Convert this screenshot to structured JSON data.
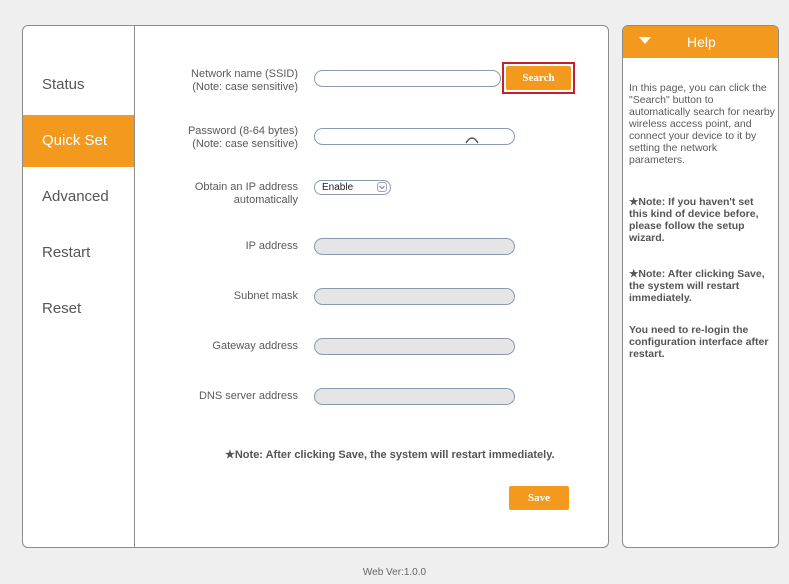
{
  "sidebar": {
    "items": [
      {
        "label": "Status",
        "active": false
      },
      {
        "label": "Quick Set",
        "active": true
      },
      {
        "label": "Advanced",
        "active": false
      },
      {
        "label": "Restart",
        "active": false
      },
      {
        "label": "Reset",
        "active": false
      }
    ]
  },
  "form": {
    "ssid": {
      "label_line1": "Network name (SSID)",
      "label_line2": "(Note: case sensitive)",
      "value": ""
    },
    "search_label": "Search",
    "password": {
      "label_line1": "Password (8-64 bytes)",
      "label_line2": "(Note: case sensitive)",
      "value": ""
    },
    "obtain_ip": {
      "label_line1": "Obtain an IP address",
      "label_line2": "automatically",
      "selected": "Enable"
    },
    "ip_address": {
      "label": "IP address",
      "value": ""
    },
    "subnet_mask": {
      "label": "Subnet mask",
      "value": ""
    },
    "gateway": {
      "label": "Gateway address",
      "value": ""
    },
    "dns": {
      "label": "DNS server address",
      "value": ""
    },
    "note": "★Note: After clicking Save, the system will restart immediately.",
    "save_label": "Save"
  },
  "help": {
    "title": "Help",
    "paragraph1": "In this page, you can click the \"Search\" button to automatically search for nearby wireless access point, and connect your device to it by setting the network parameters.",
    "note1": "★Note: If you haven't set this kind of device before, please follow the setup wizard.",
    "note2": "★Note: After clicking Save, the system will restart immediately.",
    "note3": "You need to re-login the configuration interface after restart."
  },
  "footer": {
    "version": "Web Ver:1.0.0"
  },
  "colors": {
    "accent": "#f39a1e",
    "search_frame": "#c8202a"
  },
  "icons": {
    "password_toggle": "eye-icon",
    "select_chevron": "chevron-down-icon",
    "help_toggle": "triangle-down-icon"
  }
}
